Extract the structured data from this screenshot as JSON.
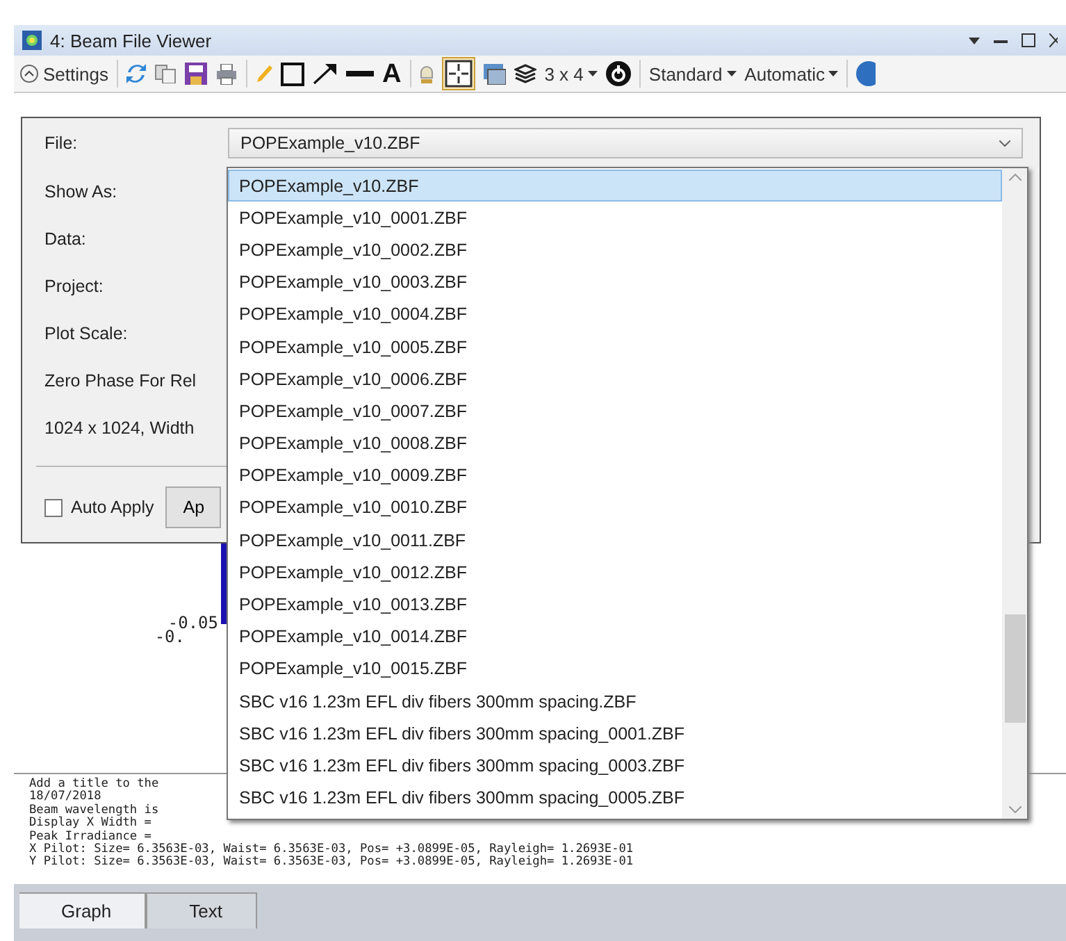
{
  "window": {
    "title": "4: Beam File Viewer"
  },
  "toolbar": {
    "settings_label": "Settings",
    "text_tool": "A",
    "grid_toggle": {
      "on": true
    },
    "layout": "3 x 4",
    "menus": [
      "Standard",
      "Automatic"
    ]
  },
  "settings": {
    "fields": [
      {
        "label": "File:",
        "value": "POPExample_v10.ZBF"
      },
      {
        "label": "Show As:"
      },
      {
        "label": "Data:"
      },
      {
        "label": "Project:"
      },
      {
        "label": "Plot Scale:"
      }
    ],
    "notes": [
      "Zero Phase For Rel",
      "1024 x 1024, Width"
    ],
    "auto_apply": {
      "label": "Auto Apply",
      "checked": false
    },
    "apply_button": "Ap"
  },
  "dropdown": {
    "items": [
      {
        "label": "POPExample_v10.ZBF",
        "selected": true
      },
      {
        "label": "POPExample_v10_0001.ZBF",
        "selected": false
      },
      {
        "label": "POPExample_v10_0002.ZBF",
        "selected": false
      },
      {
        "label": "POPExample_v10_0003.ZBF",
        "selected": false
      },
      {
        "label": "POPExample_v10_0004.ZBF",
        "selected": false
      },
      {
        "label": "POPExample_v10_0005.ZBF",
        "selected": false
      },
      {
        "label": "POPExample_v10_0006.ZBF",
        "selected": false
      },
      {
        "label": "POPExample_v10_0007.ZBF",
        "selected": false
      },
      {
        "label": "POPExample_v10_0008.ZBF",
        "selected": false
      },
      {
        "label": "POPExample_v10_0009.ZBF",
        "selected": false
      },
      {
        "label": "POPExample_v10_0010.ZBF",
        "selected": false
      },
      {
        "label": "POPExample_v10_0011.ZBF",
        "selected": false
      },
      {
        "label": "POPExample_v10_0012.ZBF",
        "selected": false
      },
      {
        "label": "POPExample_v10_0013.ZBF",
        "selected": false
      },
      {
        "label": "POPExample_v10_0014.ZBF",
        "selected": false
      },
      {
        "label": "POPExample_v10_0015.ZBF",
        "selected": false
      },
      {
        "label": "SBC v16 1.23m EFL div fibers 300mm spacing.ZBF",
        "selected": false
      },
      {
        "label": "SBC v16 1.23m EFL div fibers 300mm spacing_0001.ZBF",
        "selected": false
      },
      {
        "label": "SBC v16 1.23m EFL div fibers 300mm spacing_0003.ZBF",
        "selected": false
      },
      {
        "label": "SBC v16 1.23m EFL div fibers 300mm spacing_0005.ZBF",
        "selected": false
      }
    ]
  },
  "plot": {
    "labels": [
      "-0.05",
      "-0."
    ]
  },
  "text_panel": {
    "lines": [
      "Add a title to the",
      "18/07/2018",
      "Beam wavelength is",
      "Display X Width =",
      "Peak Irradiance =",
      "X Pilot: Size= 6.3563E-03, Waist= 6.3563E-03, Pos= +3.0899E-05, Rayleigh= 1.2693E-01",
      "Y Pilot: Size= 6.3563E-03, Waist= 6.3563E-03, Pos= +3.0899E-05, Rayleigh= 1.2693E-01"
    ]
  },
  "tabs": [
    {
      "label": "Graph",
      "selected": true
    },
    {
      "label": "Text",
      "selected": false
    }
  ]
}
